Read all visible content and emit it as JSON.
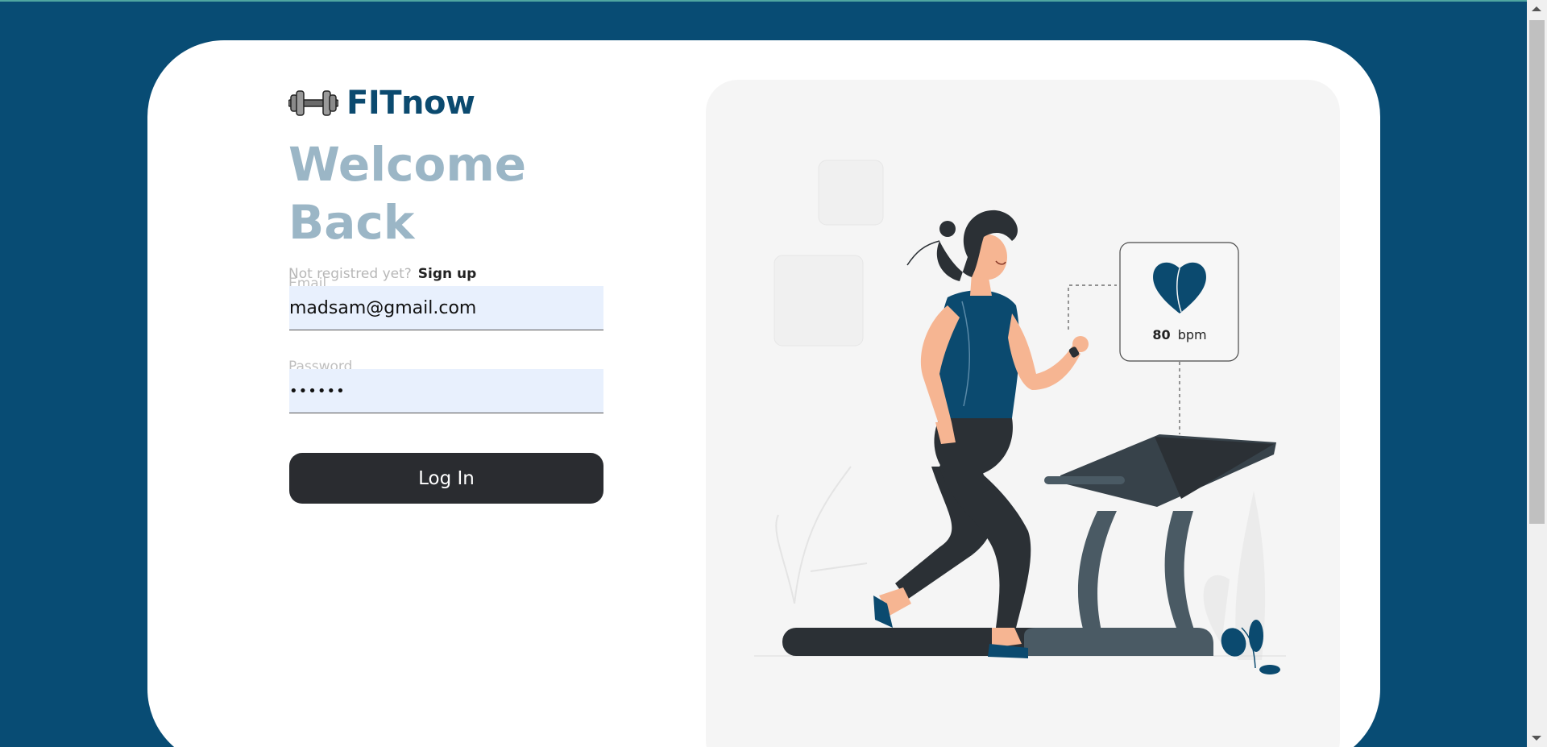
{
  "brand": {
    "name": "FITnow",
    "logo_icon": "dumbbell-icon"
  },
  "heading": {
    "line1": "Welcome",
    "line2": "Back"
  },
  "signup": {
    "prompt": "Not registred yet?",
    "link": "Sign up"
  },
  "email": {
    "label": "Email",
    "value": "madsam@gmail.com"
  },
  "password": {
    "label": "Password",
    "value": "••••••"
  },
  "login_button": {
    "label": "Log In"
  },
  "illustration": {
    "heart_rate_value": "80",
    "heart_rate_unit": "bpm",
    "heart_icon": "heart-icon"
  },
  "colors": {
    "background": "#084c74",
    "brand": "#0b4a6f",
    "heading": "#9bb6c6",
    "button": "#2a2c30",
    "input_bg": "#e8f0fd"
  }
}
